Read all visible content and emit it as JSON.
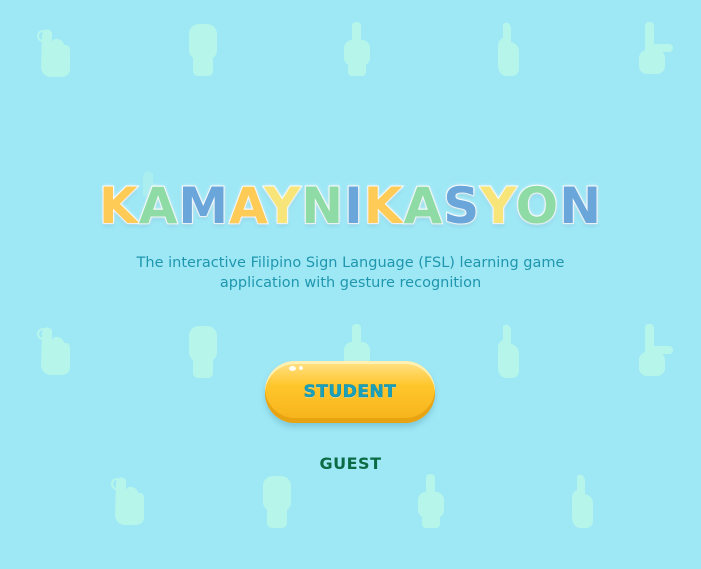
{
  "app": {
    "title_letters": [
      {
        "char": "K",
        "color": "#ffcb57"
      },
      {
        "char": "A",
        "color": "#8fdba6"
      },
      {
        "char": "M",
        "color": "#6ba6da"
      },
      {
        "char": "A",
        "color": "#ffcb57"
      },
      {
        "char": "Y",
        "color": "#f7e57a"
      },
      {
        "char": "N",
        "color": "#8fdba6"
      },
      {
        "char": "I",
        "color": "#6ba6da"
      },
      {
        "char": "K",
        "color": "#ffcb57"
      },
      {
        "char": "A",
        "color": "#8fdba6"
      },
      {
        "char": "S",
        "color": "#6ba6da"
      },
      {
        "char": "Y",
        "color": "#f7e57a"
      },
      {
        "char": "O",
        "color": "#8fdba6"
      },
      {
        "char": "N",
        "color": "#6ba6da"
      }
    ],
    "subtitle_line1": "The interactive Filipino Sign Language (FSL) learning game",
    "subtitle_line2": "application with gesture recognition"
  },
  "buttons": {
    "student_label": "STUDENT",
    "guest_label": "GUEST"
  },
  "colors": {
    "background": "#9ee8f6",
    "hand_pattern": "#b6f5ea",
    "subtitle": "#1f96ad",
    "student_button": "#ffc62b",
    "student_text": "#1aa2bd",
    "guest_text": "#0b6b45"
  },
  "background_pattern": {
    "icons": [
      "hand-sign-icon"
    ]
  }
}
